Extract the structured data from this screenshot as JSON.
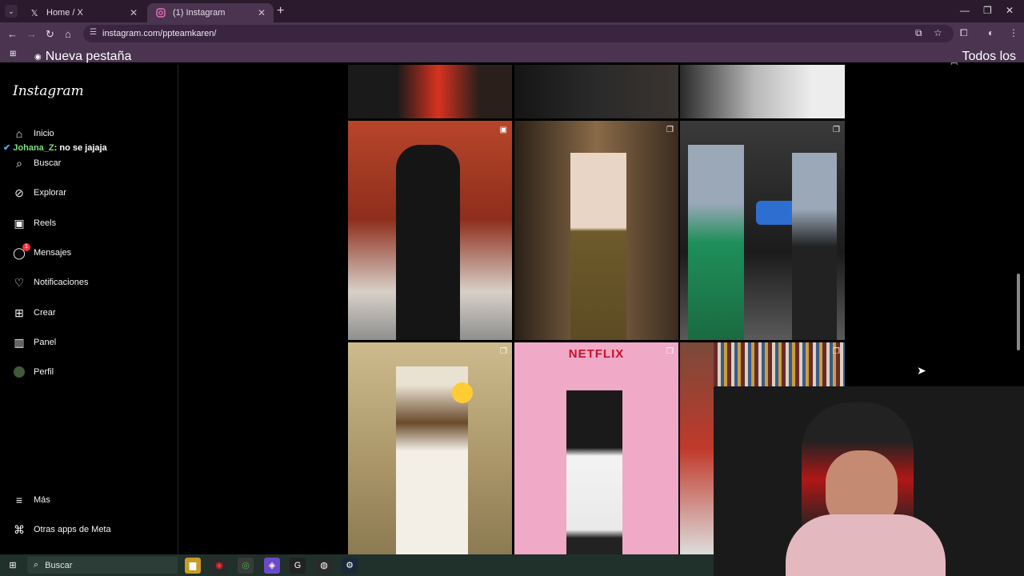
{
  "browser": {
    "tabs": [
      {
        "label": "Home / X",
        "icon": "x-logo-icon",
        "active": false
      },
      {
        "label": "(1) Instagram",
        "icon": "instagram-icon",
        "active": true
      }
    ],
    "url": "instagram.com/ppteamkaren/",
    "bookmarks": {
      "new_tab": "Nueva pestaña",
      "favorites": "Todos los favoritos"
    }
  },
  "sidebar": {
    "logo": "Instagram",
    "items": [
      {
        "label": "Inicio",
        "icon": "home-icon"
      },
      {
        "label": "Buscar",
        "icon": "search-icon"
      },
      {
        "label": "Explorar",
        "icon": "compass-icon"
      },
      {
        "label": "Reels",
        "icon": "reels-icon"
      },
      {
        "label": "Mensajes",
        "icon": "messenger-icon",
        "badge": "1"
      },
      {
        "label": "Notificaciones",
        "icon": "heart-icon"
      },
      {
        "label": "Crear",
        "icon": "plus-square-icon"
      },
      {
        "label": "Panel",
        "icon": "chart-icon"
      },
      {
        "label": "Perfil",
        "icon": "avatar-icon"
      },
      {
        "label": "Más",
        "icon": "menu-icon"
      },
      {
        "label": "Otras apps de Meta",
        "icon": "meta-apps-icon"
      }
    ]
  },
  "chat_overlay": {
    "user": "Johana_Z",
    "message": ": no se jajaja"
  },
  "grid": {
    "netflix_label": "NETFLIX"
  },
  "taskbar": {
    "search": "Buscar"
  },
  "colors": {
    "browser_bg": "#2b1a2e",
    "toolbar": "#4a3450",
    "page_bg": "#000000",
    "badge": "#ff3040",
    "chat_user": "#7fe07f"
  }
}
